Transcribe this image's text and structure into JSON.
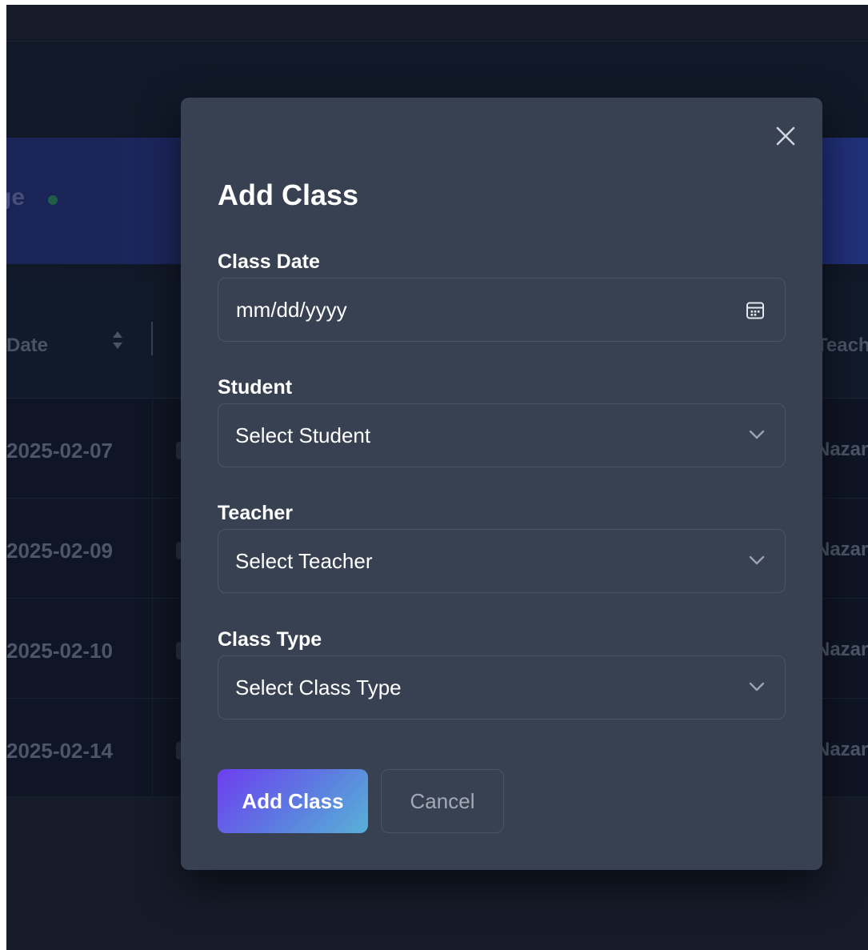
{
  "background": {
    "banner_title": "ge",
    "table": {
      "headers": {
        "date": "Date",
        "teacher": "Teach"
      },
      "rows": [
        {
          "date": "2025-02-07",
          "teacher": "Nazar"
        },
        {
          "date": "2025-02-09",
          "teacher": "Nazar"
        },
        {
          "date": "2025-02-10",
          "teacher": "Nazar"
        },
        {
          "date": "2025-02-14",
          "teacher": "Nazar"
        }
      ]
    }
  },
  "modal": {
    "title": "Add Class",
    "fields": {
      "class_date": {
        "label": "Class Date",
        "placeholder": "mm/dd/yyyy",
        "icon": "calendar-icon"
      },
      "student": {
        "label": "Student",
        "selected": "Select Student",
        "icon": "chevron-down-icon"
      },
      "teacher": {
        "label": "Teacher",
        "selected": "Select Teacher",
        "icon": "chevron-down-icon"
      },
      "class_type": {
        "label": "Class Type",
        "selected": "Select Class Type",
        "icon": "chevron-down-icon"
      }
    },
    "buttons": {
      "submit_label": "Add Class",
      "cancel_label": "Cancel"
    },
    "close_icon": "close-icon"
  },
  "colors": {
    "modal_bg": "#374151",
    "page_bg": "#111827",
    "primary_gradient_start": "#6d3ef0",
    "primary_gradient_end": "#58b2d6",
    "status_dot": "#1f5d47"
  }
}
